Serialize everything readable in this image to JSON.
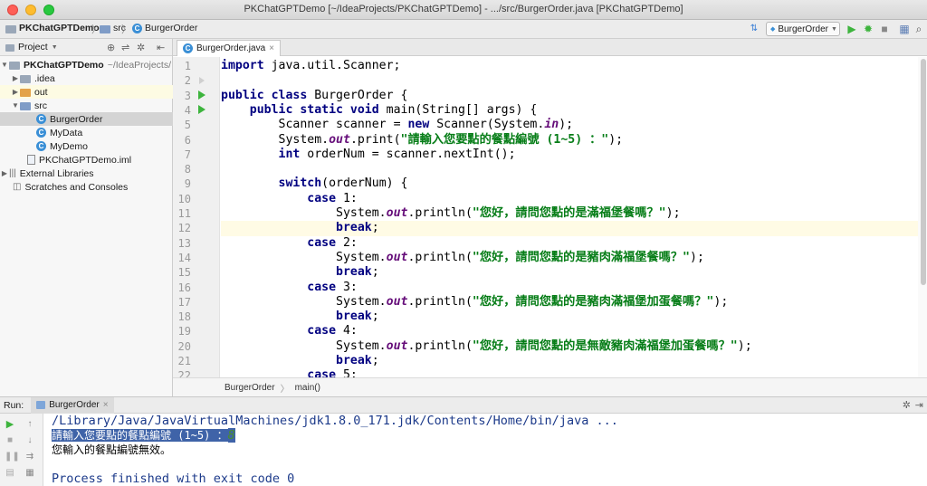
{
  "window": {
    "title": "PKChatGPTDemo [~/IdeaProjects/PKChatGPTDemo] - .../src/BurgerOrder.java [PKChatGPTDemo]"
  },
  "navbar": {
    "crumbs": [
      "PKChatGPTDemo",
      "src",
      "BurgerOrder"
    ],
    "separator": "〉",
    "run_config": "BurgerOrder"
  },
  "project_panel": {
    "header": "Project",
    "tree": [
      {
        "label": "PKChatGPTDemo",
        "suffix": "~/IdeaProjects/",
        "icon": "folder-icon"
      },
      {
        "label": ".idea",
        "icon": "folder-icon"
      },
      {
        "label": "out",
        "icon": "folder-orange-icon"
      },
      {
        "label": "src",
        "icon": "folder-blue-icon"
      },
      {
        "label": "BurgerOrder",
        "icon": "java-class-icon"
      },
      {
        "label": "MyData",
        "icon": "java-class-icon"
      },
      {
        "label": "MyDemo",
        "icon": "java-class-icon"
      },
      {
        "label": "PKChatGPTDemo.iml",
        "icon": "iml-file-icon"
      },
      {
        "label": "External Libraries",
        "icon": "library-icon"
      },
      {
        "label": "Scratches and Consoles",
        "icon": "scratch-icon"
      }
    ]
  },
  "editor": {
    "tab_label": "BurgerOrder.java",
    "tab_close": "×",
    "line_numbers": [
      "1",
      "2",
      "3",
      "4",
      "5",
      "6",
      "7",
      "8",
      "9",
      "10",
      "11",
      "12",
      "13",
      "14",
      "15",
      "16",
      "17",
      "18",
      "19",
      "20",
      "21",
      "22"
    ],
    "breadcrumbs": [
      "BurgerOrder",
      "main()"
    ],
    "breadcrumb_sep": "〉",
    "code": {
      "import_kw": "import",
      "import_rest": " java.util.Scanner;",
      "class_kw": "public class",
      "class_rest": " BurgerOrder {",
      "main_kw": "public static void",
      "main_rest": " main(String[] args) {",
      "scanner_a": "Scanner scanner = ",
      "new_kw": "new",
      "scanner_b": " Scanner(System.",
      "in_fld": "in",
      "scanner_c": ");",
      "print_a": "System.",
      "out_fld": "out",
      "print_b": ".print(",
      "prompt_str": "\"請輸入您要點的餐點編號 (1~5) ：\"",
      "print_c": ");",
      "int_kw": "int",
      "int_rest": " orderNum = scanner.nextInt();",
      "switch_kw": "switch",
      "switch_rest": "(orderNum) {",
      "case_kw": "case",
      "case1": " 1:",
      "case2": " 2:",
      "case3": " 3:",
      "case4": " 4:",
      "case5": " 5:",
      "println_a": "System.",
      "println_b": ".println(",
      "println_c": ");",
      "msg1": "\"您好，請問您點的是滿福堡餐嗎？\"",
      "msg2": "\"您好，請問您點的是豬肉滿福堡餐嗎？\"",
      "msg3": "\"您好，請問您點的是豬肉滿福堡加蛋餐嗎？\"",
      "msg4": "\"您好，請問您點的是無敵豬肉滿福堡加蛋餐嗎？\"",
      "break_kw": "break",
      "semi": ";"
    }
  },
  "run_panel": {
    "label": "Run:",
    "tab": "BurgerOrder",
    "tab_close": "×",
    "console": {
      "java_path": "/Library/Java/JavaVirtualMachines/jdk1.8.0_171.jdk/Contents/Home/bin/java ...",
      "prompt": "請輸入您要點的餐點編號 (1~5) ：",
      "user_input": "8",
      "invalid_msg": "您輸入的餐點編號無效。",
      "exit_msg": "Process finished with exit code 0"
    }
  },
  "colors": {
    "keyword": "#000080",
    "string": "#067d17",
    "field": "#660e7a",
    "selection": "#3f63a8",
    "run_green": "#3db43d"
  }
}
